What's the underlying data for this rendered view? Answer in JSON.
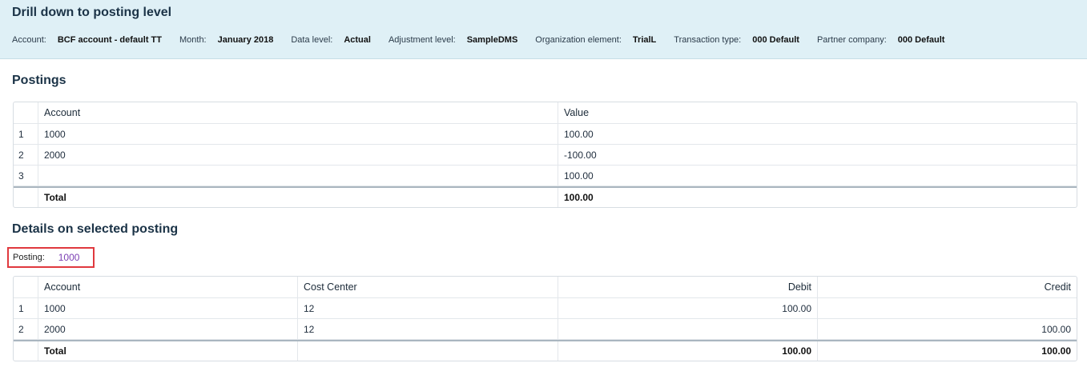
{
  "header": {
    "title": "Drill down to posting level",
    "fields": [
      {
        "label": "Account:",
        "value": "BCF account - default TT"
      },
      {
        "label": "Month:",
        "value": "January 2018"
      },
      {
        "label": "Data level:",
        "value": "Actual"
      },
      {
        "label": "Adjustment level:",
        "value": "SampleDMS"
      },
      {
        "label": "Organization element:",
        "value": "TrialL"
      },
      {
        "label": "Transaction type:",
        "value": "000 Default"
      },
      {
        "label": "Partner company:",
        "value": "000 Default"
      }
    ]
  },
  "postings": {
    "title": "Postings",
    "columns": [
      "Account",
      "Value"
    ],
    "rows": [
      {
        "index": "1",
        "account": "1000",
        "value": "100.00"
      },
      {
        "index": "2",
        "account": "2000",
        "value": "-100.00"
      },
      {
        "index": "3",
        "account": "",
        "value": "100.00"
      }
    ],
    "total": {
      "label": "Total",
      "value": "100.00"
    }
  },
  "details": {
    "title": "Details on selected posting",
    "posting_label": "Posting:",
    "posting_value": "1000",
    "columns": [
      "Account",
      "Cost Center",
      "Debit",
      "Credit"
    ],
    "rows": [
      {
        "index": "1",
        "account": "1000",
        "cost_center": "12",
        "debit": "100.00",
        "credit": ""
      },
      {
        "index": "2",
        "account": "2000",
        "cost_center": "12",
        "debit": "",
        "credit": "100.00"
      }
    ],
    "total": {
      "label": "Total",
      "cost_center": "",
      "debit": "100.00",
      "credit": "100.00"
    }
  },
  "colors": {
    "header_bg": "#dff0f6",
    "highlight_border": "#e0393e",
    "link_value": "#7b3fb3"
  }
}
